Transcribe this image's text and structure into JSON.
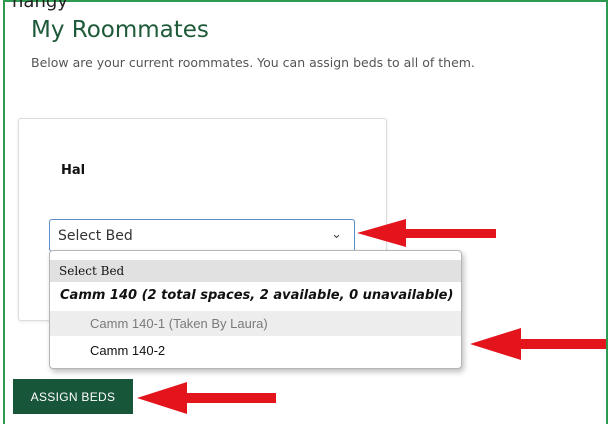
{
  "clipped_header": "hangy",
  "page": {
    "title": "My Roommates",
    "subtitle": "Below are your current roommates. You can assign beds to all of them."
  },
  "roommate": {
    "name": "Hal",
    "select_value": "Select Bed"
  },
  "dropdown": {
    "placeholder_option": "Select Bed",
    "group_label": "Camm 140 (2 total spaces, 2 available, 0 unavailable)",
    "options": [
      {
        "label": "Camm 140-1 (Taken By Laura)",
        "disabled": true
      },
      {
        "label": "Camm 140-2",
        "disabled": false
      }
    ]
  },
  "actions": {
    "assign_label": "ASSIGN BEDS"
  },
  "colors": {
    "frame": "#2e9a4f",
    "title": "#1e5a3a",
    "button_bg": "#18563a",
    "annotation_arrow": "#e3141b",
    "select_border": "#5a8fc7"
  }
}
